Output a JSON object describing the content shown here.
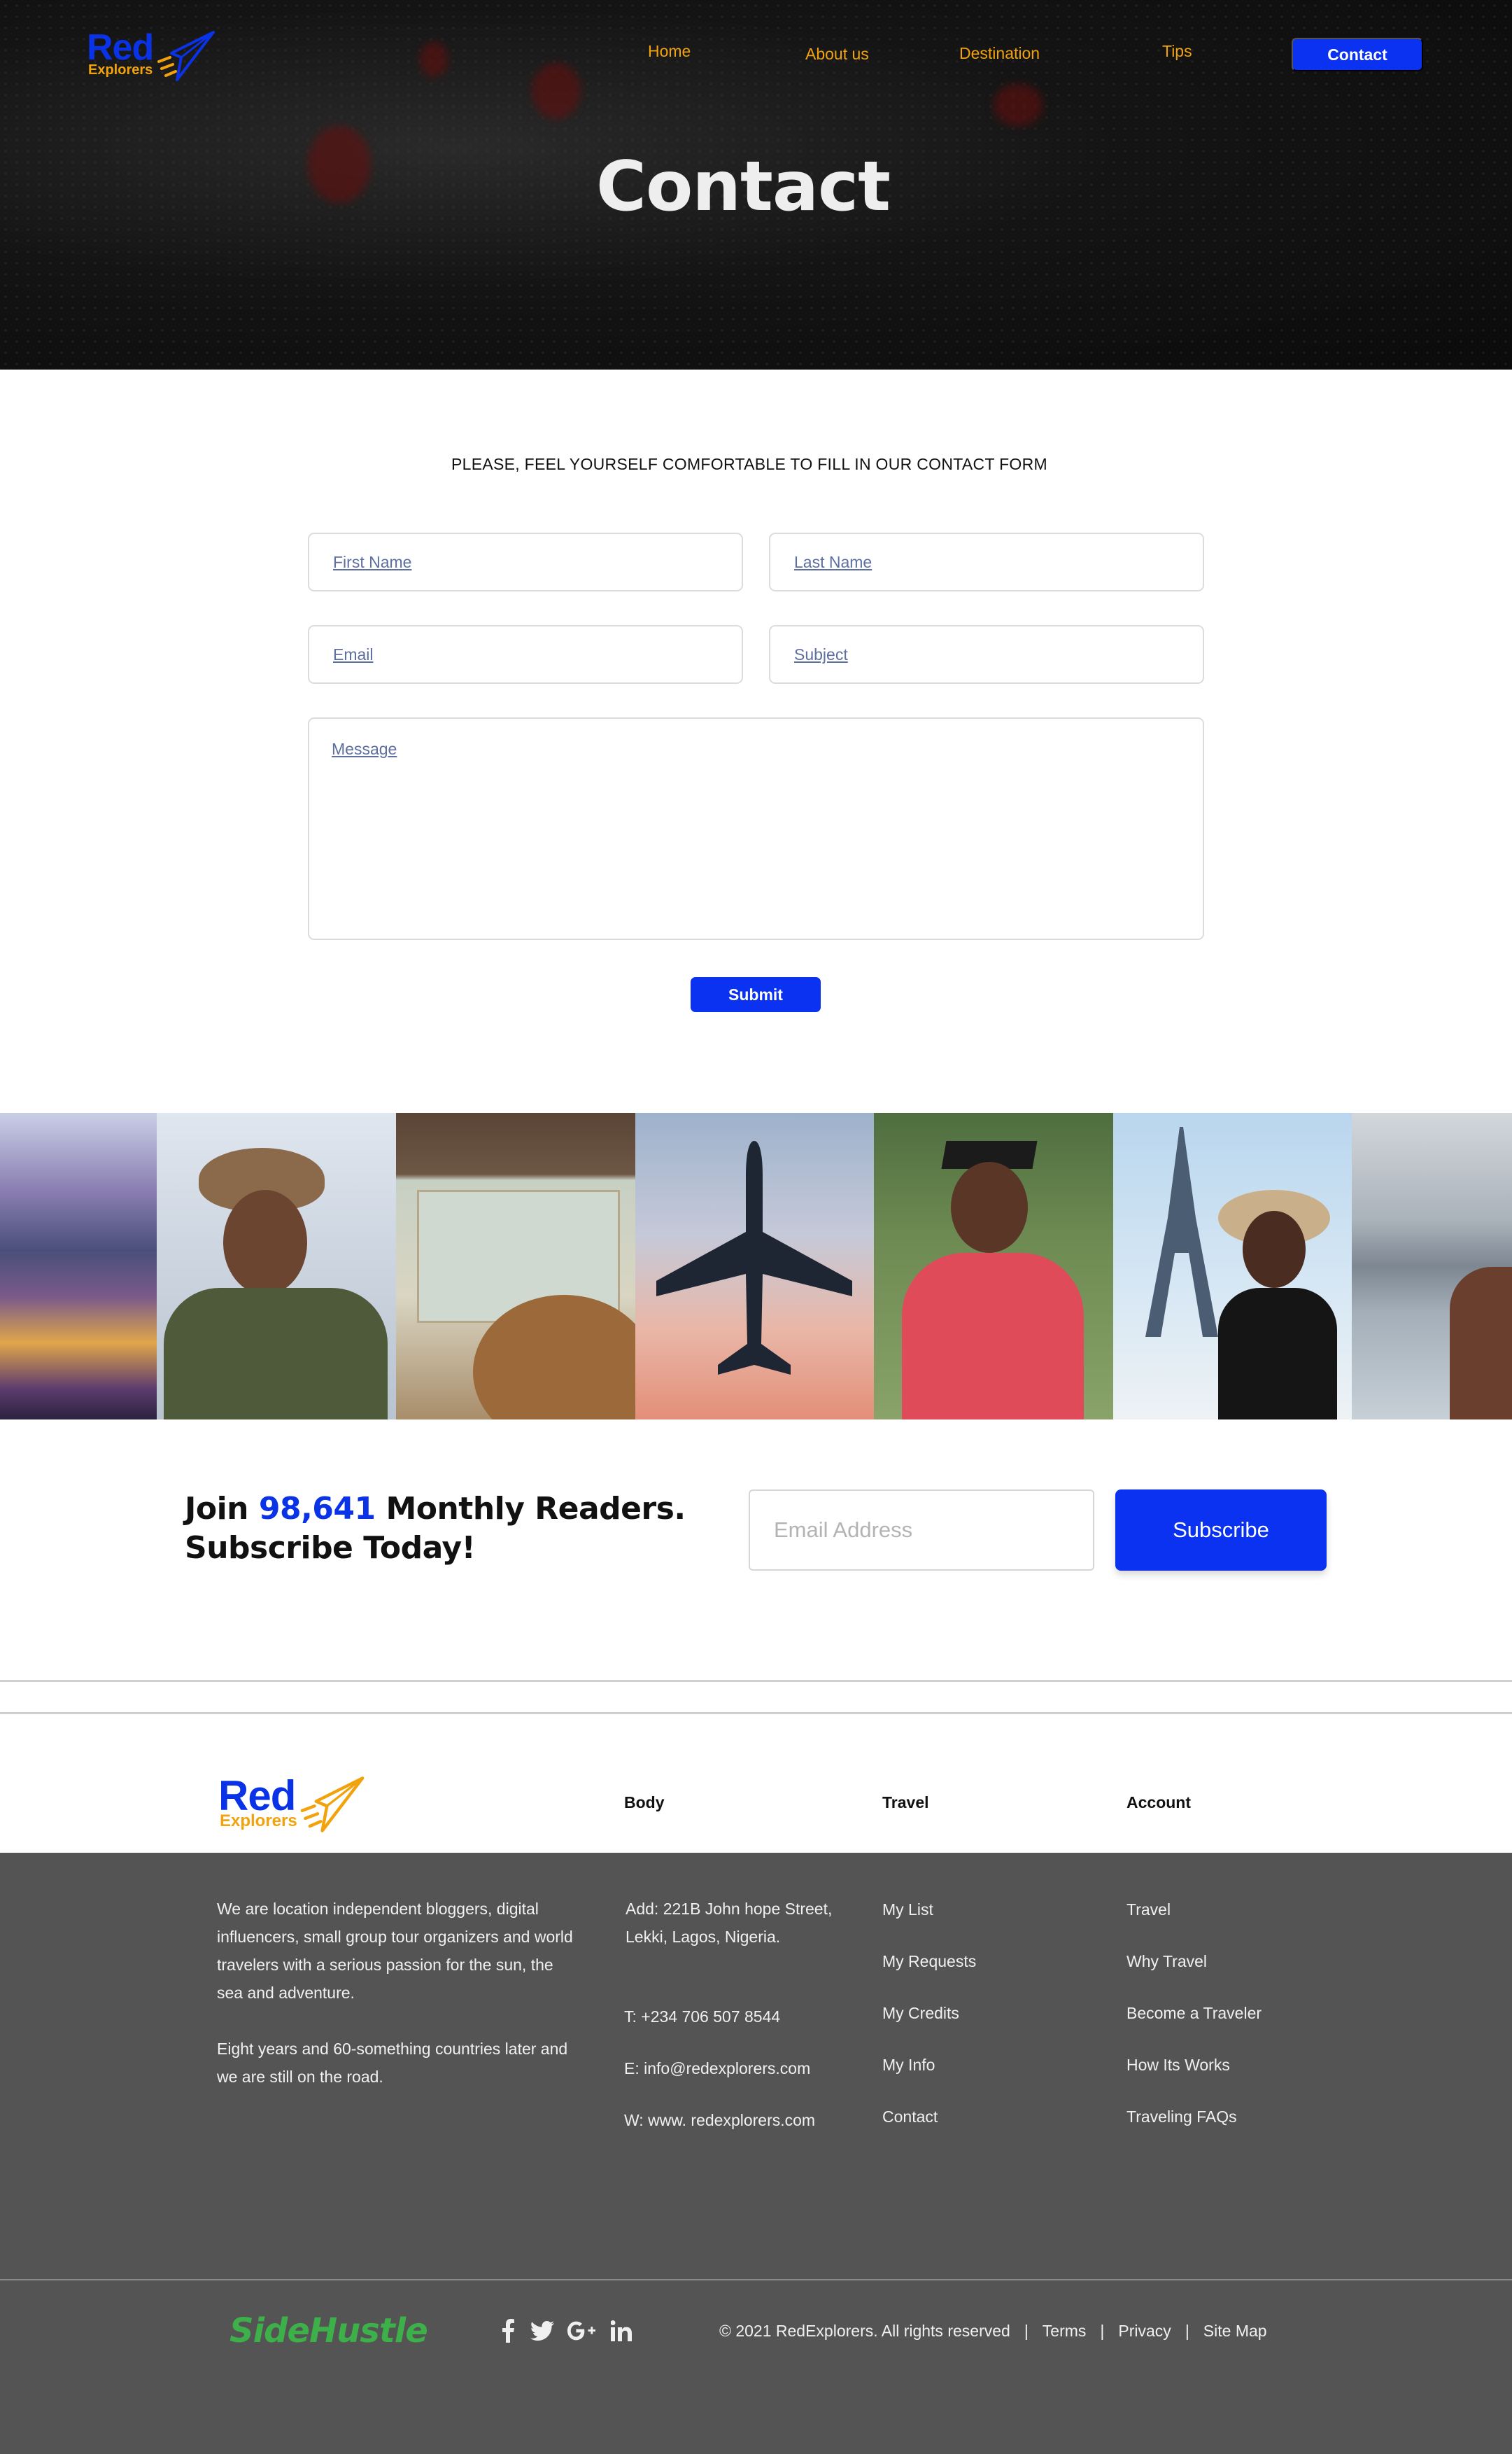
{
  "nav": {
    "logo_main": "Red",
    "logo_sub": "Explorers",
    "home": "Home",
    "about": "About us",
    "destination": "Destination",
    "tips": "Tips",
    "contact_button": "Contact"
  },
  "hero": {
    "title": "Contact"
  },
  "form": {
    "intro": "PLEASE, FEEL YOURSELF COMFORTABLE TO FILL IN OUR CONTACT FORM",
    "first_name_placeholder": "First Name",
    "last_name_placeholder": "Last Name",
    "email_placeholder": "Email",
    "subject_placeholder": "Subject",
    "message_placeholder": "Message",
    "submit_label": "Submit"
  },
  "gallery": {
    "photos": [
      "coastal-town-photo",
      "woman-hat-photo",
      "map-hat-photo",
      "airplane-sky-photo",
      "graduate-photo",
      "eiffel-tower-photo",
      "lake-mountains-photo"
    ]
  },
  "newsletter": {
    "join_prefix": "Join",
    "reader_count": "98,641",
    "join_suffix": "Monthly Readers.",
    "line2": "Subscribe Today!",
    "email_placeholder": "Email Address",
    "subscribe_label": "Subscribe"
  },
  "footer": {
    "logo_main": "Red",
    "logo_sub": "Explorers",
    "headings": {
      "body": "Body",
      "travel": "Travel",
      "account": "Account"
    },
    "about_p1": "We are location independent bloggers, digital influencers, small group tour organizers and world travelers with a serious passion for the sun, the sea and adventure.",
    "about_p2": "Eight years and 60-something countries later and we are still on the road.",
    "address": "Add: 221B John hope Street, Lekki, Lagos, Nigeria.",
    "phone": "T: +234 706 507 8544",
    "email": "E: info@redexplorers.com",
    "web": "W: www. redexplorers.com",
    "travel_links": [
      "My List",
      "My Requests",
      "My Credits",
      "My Info",
      "Contact"
    ],
    "account_links": [
      "Travel",
      "Why Travel",
      "Become a Traveler",
      "How Its Works",
      "Traveling FAQs"
    ],
    "brand": "SideHustle",
    "copyright": "© 2021 RedExplorers. All rights reserved",
    "terms": "Terms",
    "privacy": "Privacy",
    "sitemap": "Site Map",
    "separator": "|"
  },
  "colors": {
    "brand_blue": "#0a32f0",
    "accent_orange": "#f2a20c",
    "footer_bg": "#545454"
  }
}
